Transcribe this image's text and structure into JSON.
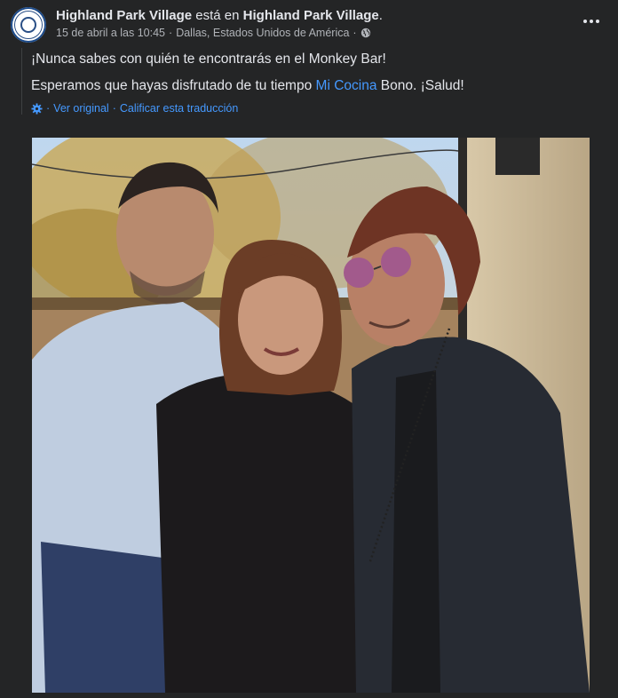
{
  "post": {
    "page_name": "Highland Park Village",
    "action_text": " está en ",
    "location_name": "Highland Park Village",
    "location_suffix": ".",
    "timestamp": "15 de abril a las 10:45",
    "separator": " · ",
    "place": "Dallas, Estados Unidos de América",
    "privacy_icon": "globe-icon",
    "more_icon": "more-options-icon",
    "line1": "¡Nunca sabes con quién te encontrarás en el Monkey Bar!",
    "line2_before": "Esperamos que hayas disfrutado de tu tiempo ",
    "line2_link": "Mi Cocina",
    "line2_after": " Bono. ¡Salud!",
    "translate_icon": "gear-icon",
    "see_original": "Ver original",
    "rate_translation": "Calificar esta traducción",
    "photo_alt": "Three people posing outdoors at a bar patio"
  },
  "colors": {
    "background": "#242526",
    "text": "#e4e6eb",
    "secondary_text": "#b0b3b8",
    "link": "#4599ff"
  }
}
